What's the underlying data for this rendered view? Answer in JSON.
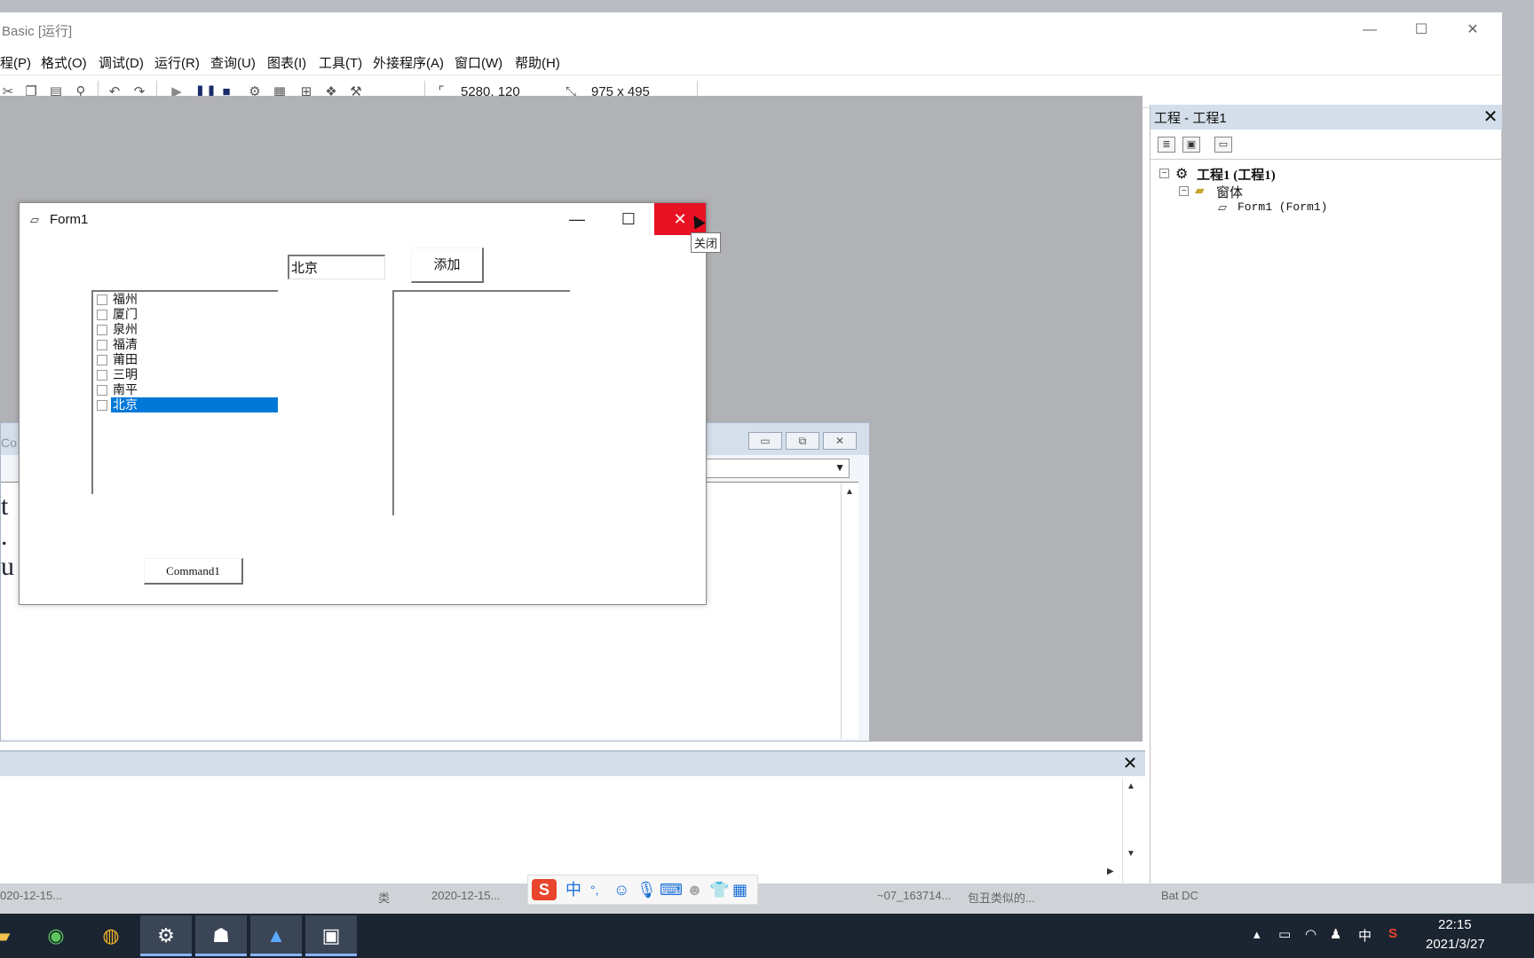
{
  "ide": {
    "title": "Basic [运行]",
    "window_controls": {
      "minimize": "—",
      "maximize": "☐",
      "close": "✕"
    },
    "menus": [
      "程(P)",
      "格式(O)",
      "调试(D)",
      "运行(R)",
      "查询(U)",
      "图表(I)",
      "工具(T)",
      "外接程序(A)",
      "窗口(W)",
      "帮助(H)"
    ],
    "toolbar": {
      "position_readout": "5280, 120",
      "size_readout": "975 x 495"
    }
  },
  "code_window": {
    "title_fragment": "Co",
    "code_fragments": [
      "t",
      ".",
      "u"
    ],
    "controls": {
      "minimize": "▭",
      "restore": "⧉",
      "close": "✕"
    }
  },
  "form1": {
    "title": "Form1",
    "controls": {
      "minimize": "—",
      "maximize": "☐",
      "close": "✕"
    },
    "close_tooltip": "关闭",
    "input_value": "北京",
    "add_button": "添加",
    "command_button": "Command1",
    "city_list": [
      {
        "label": "福州",
        "checked": false,
        "selected": false
      },
      {
        "label": "厦门",
        "checked": false,
        "selected": false
      },
      {
        "label": "泉州",
        "checked": false,
        "selected": false
      },
      {
        "label": "福清",
        "checked": false,
        "selected": false
      },
      {
        "label": "莆田",
        "checked": false,
        "selected": false
      },
      {
        "label": "三明",
        "checked": false,
        "selected": false
      },
      {
        "label": "南平",
        "checked": false,
        "selected": false
      },
      {
        "label": "北京",
        "checked": false,
        "selected": true
      }
    ],
    "selection_color": "#0078d7"
  },
  "project_explorer": {
    "title": "工程 - 工程1",
    "close": "✕",
    "tree": {
      "project": "工程1 (工程1)",
      "folder": "窗体",
      "form": "Form1 (Form1)"
    }
  },
  "immediate_window": {
    "close": "✕"
  },
  "desktop_strip": [
    "020-12-15...",
    "类",
    "2020-12-15...",
    "~07_163714...",
    "包丑类似的...",
    "Bat DC"
  ],
  "ime_bar": {
    "mode": "中",
    "punct": "°,",
    "items": [
      "emoji-icon",
      "mic-icon",
      "keyboard-icon",
      "user-icon",
      "shirt-icon",
      "grid-icon"
    ]
  },
  "taskbar": {
    "tray_lang": "中",
    "time": "22:15",
    "date": "2021/3/27"
  }
}
